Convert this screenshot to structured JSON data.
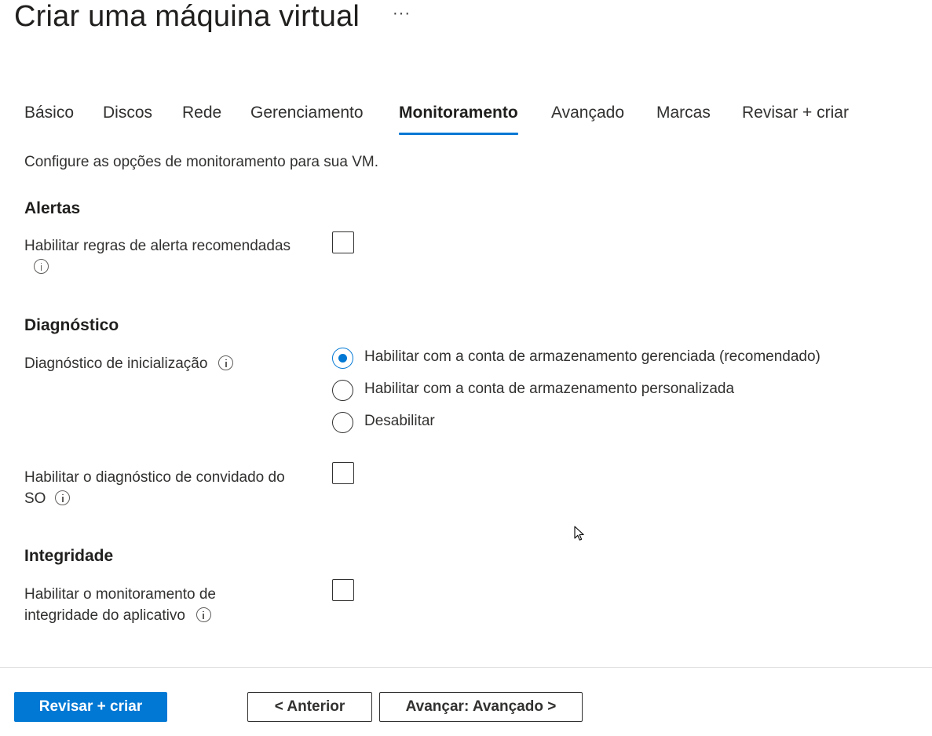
{
  "header": {
    "title": "Criar uma máquina virtual",
    "more_label": "···"
  },
  "tabs": [
    {
      "label": "Básico"
    },
    {
      "label": "Discos"
    },
    {
      "label": "Rede"
    },
    {
      "label": "Gerenciamento"
    },
    {
      "label": "Monitoramento",
      "active": true
    },
    {
      "label": "Avançado"
    },
    {
      "label": "Marcas"
    },
    {
      "label": "Revisar + criar"
    }
  ],
  "intro": "Configure as opções de monitoramento para sua VM.",
  "alerts": {
    "heading": "Alertas",
    "recommended_rules_label": "Habilitar regras de alerta recomendadas",
    "recommended_rules_checked": false
  },
  "diagnostics": {
    "heading": "Diagnóstico",
    "boot_label": "Diagnóstico de inicialização",
    "boot_options": [
      {
        "label": "Habilitar com a conta de armazenamento gerenciada (recomendado)",
        "selected": true
      },
      {
        "label": "Habilitar com a conta de armazenamento personalizada",
        "selected": false
      },
      {
        "label": "Desabilitar",
        "selected": false
      }
    ],
    "guest_os_label_line1": "Habilitar o diagnóstico de convidado do",
    "guest_os_label_line2": "SO",
    "guest_os_checked": false
  },
  "health": {
    "heading": "Integridade",
    "app_health_label_line1": "Habilitar o monitoramento de",
    "app_health_label_line2": "integridade do aplicativo",
    "app_health_checked": false
  },
  "footer": {
    "review_create": "Revisar + criar",
    "previous": "< Anterior",
    "next": "Avançar: Avançado >"
  },
  "colors": {
    "accent": "#0078d4",
    "text": "#323130",
    "divider": "#e1dfdd"
  }
}
